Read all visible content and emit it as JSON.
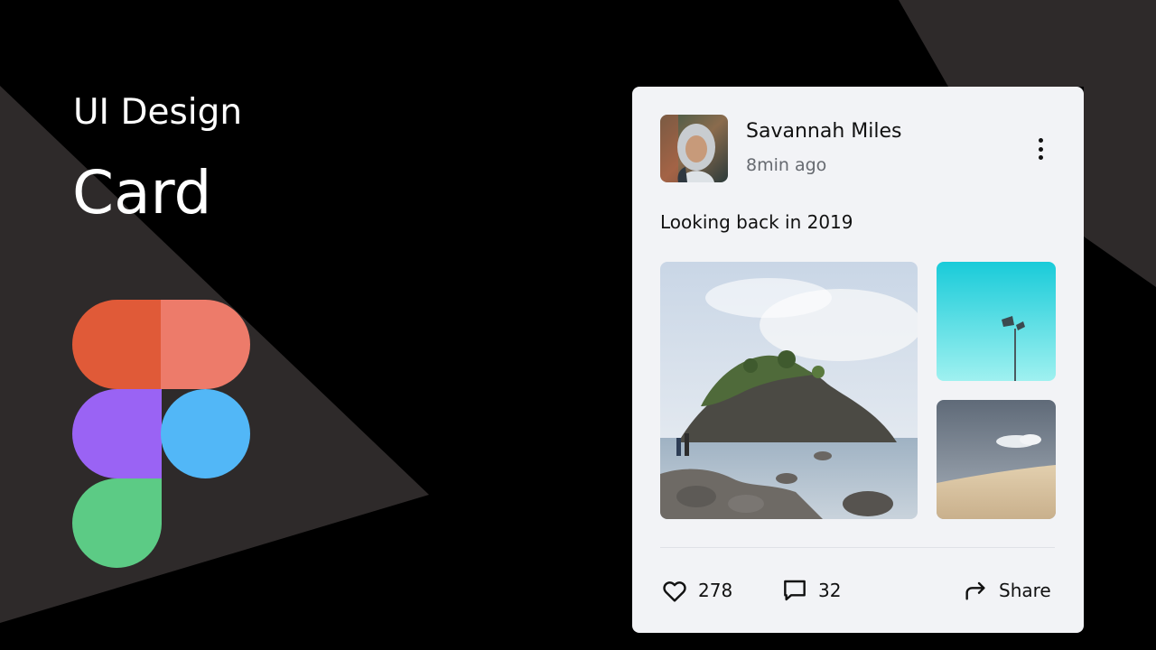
{
  "header": {
    "subtitle": "UI Design",
    "title": "Card"
  },
  "logo": {
    "icon": "figma-logo-icon",
    "colors": [
      "#e05a38",
      "#ed7b6a",
      "#9a63f4",
      "#52b7f7",
      "#5ccb85"
    ]
  },
  "card": {
    "author": {
      "name": "Savannah Miles",
      "time": "8min ago",
      "avatar_icon": "avatar"
    },
    "menu_icon": "more-vertical-icon",
    "post_text": "Looking back in 2019",
    "photos": [
      {
        "name": "rocky-island-photo"
      },
      {
        "name": "lamp-post-photo"
      },
      {
        "name": "sand-dune-photo"
      }
    ],
    "actions": {
      "likes": "278",
      "comments": "32",
      "share": "Share"
    },
    "icons": {
      "like": "heart-icon",
      "comment": "comment-icon",
      "share": "share-arrow-icon"
    }
  },
  "colors": {
    "background": "#000000",
    "shape": "#2e2a2a",
    "card": "#f2f3f6",
    "text": "#111111",
    "muted": "#666a70"
  }
}
